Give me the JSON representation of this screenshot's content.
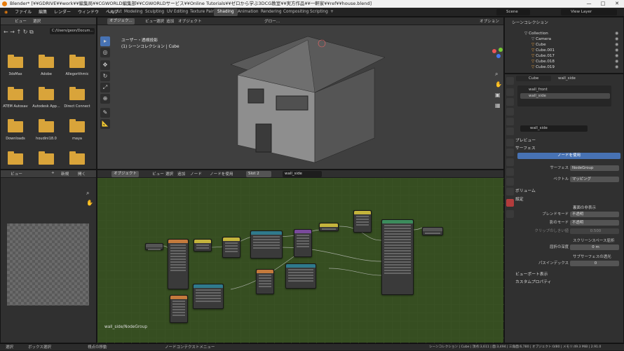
{
  "window": {
    "title": "Blender* [¥¥GDRIVE¥¥work¥¥編集局¥¥CGWORLD編集部¥¥CGWORLDサービス¥¥Online Tutorials¥¥ゼロから学ぶ3DCG教室¥¥実方作品¥¥一軒家¥¥ref¥¥house.blend]",
    "min": "—",
    "max": "□",
    "close": "✕"
  },
  "menu": [
    "ファイル",
    "編集",
    "レンダー",
    "ウィンドウ",
    "ヘルプ"
  ],
  "workspaces": [
    "Layout",
    "Modeling",
    "Sculpting",
    "UV Editing",
    "Texture Paint",
    "Shading",
    "Animation",
    "Rendering",
    "Compositing",
    "Scripting",
    "+"
  ],
  "active_workspace": "Shading",
  "scene": {
    "label": "Scene",
    "view_layer": "View Layer"
  },
  "filebrowser": {
    "header": [
      "ビュー",
      "選択"
    ],
    "path": "C:/Users/geon/Docum...",
    "folders": [
      "3dsMax",
      "Adobe",
      "Allegorithmic",
      "ATEM Autosav",
      "Autodesk App...",
      "Direct Connect",
      "Downloads",
      "houdini18.0",
      "maya",
      "",
      "",
      ""
    ]
  },
  "imageeditor": {
    "header": [
      "ビュー",
      "+",
      "新規",
      "開く"
    ]
  },
  "viewport": {
    "header": [
      "オブジェク...",
      "ビュー",
      "選択",
      "追加",
      "オブジェクト"
    ],
    "mode_label": "ユーザー・透視投影",
    "collection_label": "(1) シーンコレクション | Cube",
    "overlay": "グロー...",
    "options": "オプション"
  },
  "nodeeditor": {
    "header": [
      "オブジェクト",
      "ビュー",
      "選択",
      "追加",
      "ノード"
    ],
    "use_nodes": "ノードを使用",
    "slot": "Slot 2",
    "material": "wall_side",
    "footer": "wall_side/NodeGroup"
  },
  "outliner": {
    "title": "シーンコレクション",
    "items": [
      "Collection",
      "Camera",
      "Cube",
      "Cube.001",
      "Cube.017",
      "Cube.018",
      "Cube.019"
    ]
  },
  "properties": {
    "object": "Cube",
    "material": "wall_side",
    "slots": [
      "wall_front",
      "wall_side"
    ],
    "mat_field": "wall_side",
    "sections": {
      "preview": "プレビュー",
      "surface": "サーフェス",
      "volume": "ボリューム",
      "settings": "設定",
      "viewport_display": "ビューポート表示",
      "custom": "カスタムプロパティ"
    },
    "use_nodes_btn": "ノードを使用",
    "surface_label": "サーフェス",
    "surface_val": "NodeGroup",
    "vector_label": "ベクトル",
    "vector_val": "マッピング",
    "backface": "裏面の非表示",
    "blend_label": "ブレンドモード",
    "blend_val": "不透明",
    "shadow_label": "影のモード",
    "shadow_val": "不透明",
    "clip_label": "クリップのしきい値",
    "clip_val": "0.500",
    "ssr": "スクリーンスペース屈折",
    "refr_label": "屈折の深度",
    "refr_val": "0 m",
    "sss": "サブサーフェスの透光",
    "pass_label": "パスインデックス",
    "pass_val": "0"
  },
  "status": {
    "select": "選択",
    "box": "ボックス選択",
    "pan": "視点の移動",
    "ctx": "ノードコンテクストメニュー",
    "info": "シーンコレクション | Cube | 頂点:3,611 | 面:3,494 | 三角面:6,780 | オブジェクト:0/80 | メモリ:49.3 MiB | 2.91.0"
  }
}
